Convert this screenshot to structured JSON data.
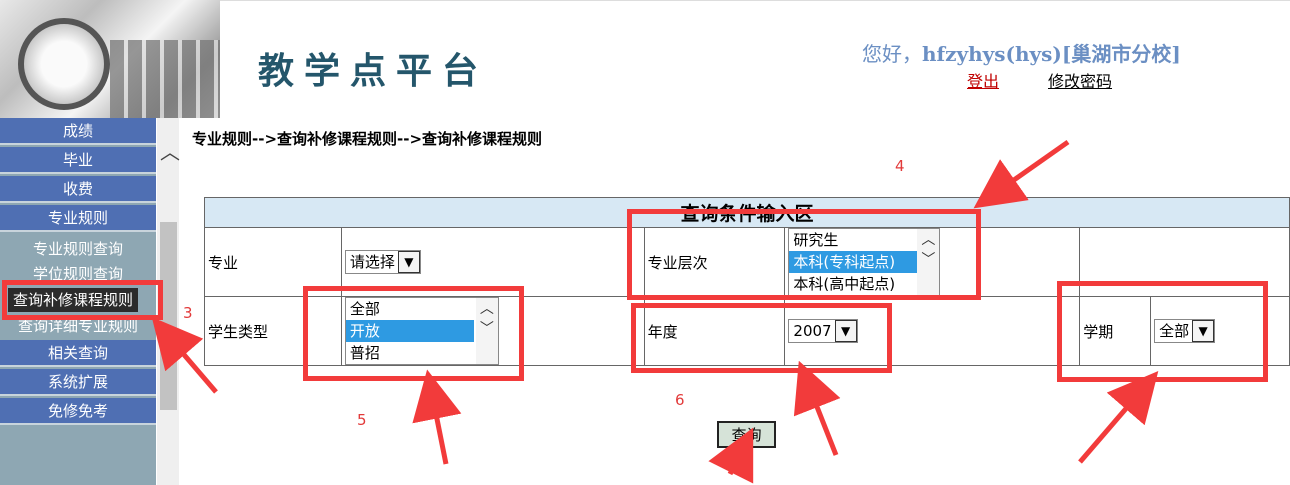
{
  "header": {
    "brand": "教学点平台",
    "greeting_prefix": "您好，",
    "username": "hfzyhys(hys)",
    "campus": "[巢湖市分校]",
    "logout": "登出",
    "change_password": "修改密码"
  },
  "sidebar": {
    "items": [
      {
        "label": "成绩"
      },
      {
        "label": "毕业"
      },
      {
        "label": "收费"
      },
      {
        "label": "专业规则"
      }
    ],
    "subitems": [
      {
        "label": "专业规则查询"
      },
      {
        "label": "学位规则查询"
      },
      {
        "label": "查询补修课程规则"
      },
      {
        "label": "查询详细专业规则"
      }
    ],
    "items_after": [
      {
        "label": "相关查询"
      },
      {
        "label": "系统扩展"
      },
      {
        "label": "免修免考"
      }
    ]
  },
  "breadcrumb": "专业规则-->查询补修课程规则-->查询补修课程规则",
  "form": {
    "title": "查询条件输入区",
    "major_label": "专业",
    "major_value": "请选择",
    "level_label": "专业层次",
    "level_options": [
      "研究生",
      "本科(专科起点)",
      "本科(高中起点)"
    ],
    "level_selected": "本科(专科起点)",
    "student_type_label": "学生类型",
    "student_type_options": [
      "全部",
      "开放",
      "普招"
    ],
    "student_type_selected": "开放",
    "year_label": "年度",
    "year_value": "2007",
    "term_label": "学期",
    "term_value": "全部",
    "submit": "查询"
  },
  "annotations": {
    "numbers": [
      "3",
      "4",
      "5",
      "6"
    ],
    "color": "#f23b3b"
  },
  "colors": {
    "menu_bg": "#4f6fb3",
    "sidebar_bg": "#8ea7b3",
    "brand": "#24566b",
    "greeting": "#6b8fc3",
    "table_title_bg": "#d7e8f4",
    "selected_option": "#2e9ae2"
  }
}
